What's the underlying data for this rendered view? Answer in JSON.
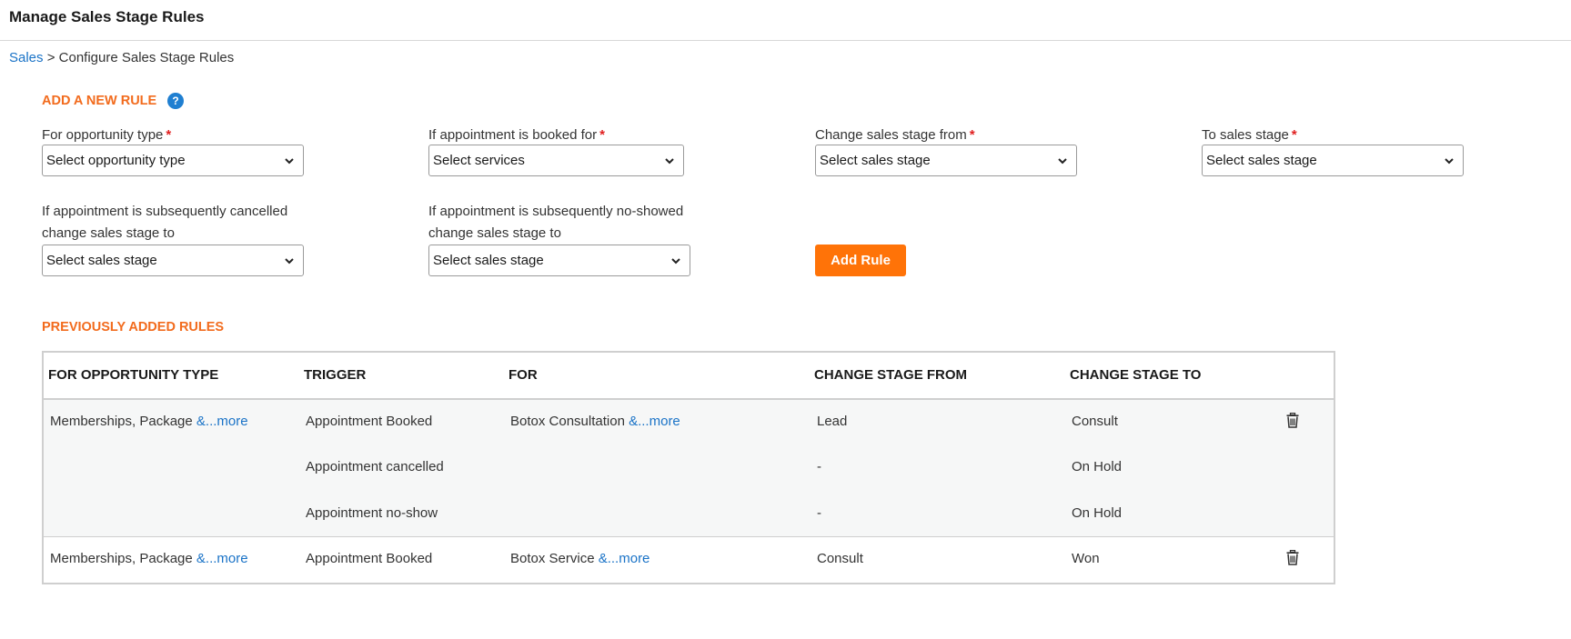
{
  "page": {
    "title": "Manage Sales Stage Rules"
  },
  "breadcrumb": {
    "link": "Sales",
    "separator": ">",
    "current": "Configure Sales Stage Rules"
  },
  "add_rule": {
    "title": "ADD A NEW RULE",
    "help": "?",
    "opportunity_type": {
      "label": "For opportunity type",
      "required": "*",
      "value": "Select opportunity type"
    },
    "booked_for": {
      "label": "If appointment is booked for",
      "required": "*",
      "value": "Select services"
    },
    "stage_from": {
      "label": "Change sales stage from",
      "required": "*",
      "value": "Select sales stage"
    },
    "stage_to": {
      "label": "To sales stage",
      "required": "*",
      "value": "Select sales stage"
    },
    "cancelled": {
      "label_line1": "If appointment is subsequently cancelled",
      "label_line2": "change sales stage to",
      "value": "Select sales stage"
    },
    "noshow": {
      "label_line1": "If appointment is subsequently no-showed",
      "label_line2": "change sales stage to",
      "value": "Select sales stage"
    },
    "button": "Add Rule"
  },
  "previous_rules": {
    "title": "PREVIOUSLY ADDED RULES",
    "columns": [
      "FOR OPPORTUNITY TYPE",
      "TRIGGER",
      "FOR",
      "CHANGE STAGE FROM",
      "CHANGE STAGE TO"
    ],
    "rules": [
      {
        "opportunity": "Memberships, Package",
        "opportunity_more": "&...more",
        "for": "Botox Consultation",
        "for_more": "&...more",
        "rows": [
          {
            "trigger": "Appointment Booked",
            "from": "Lead",
            "to": "Consult"
          },
          {
            "trigger": "Appointment cancelled",
            "from": "-",
            "to": "On Hold"
          },
          {
            "trigger": "Appointment no-show",
            "from": "-",
            "to": "On Hold"
          }
        ]
      },
      {
        "opportunity": "Memberships, Package",
        "opportunity_more": "&...more",
        "for": "Botox Service",
        "for_more": "&...more",
        "rows": [
          {
            "trigger": "Appointment Booked",
            "from": "Consult",
            "to": "Won"
          }
        ]
      }
    ]
  },
  "icons": {
    "dropdown": "chevron-down-icon",
    "delete": "trash-icon",
    "help": "help-icon"
  },
  "colors": {
    "accent": "#f26b1d",
    "button": "#ff7308",
    "link": "#1a73c7",
    "help": "#1f7fd1"
  }
}
